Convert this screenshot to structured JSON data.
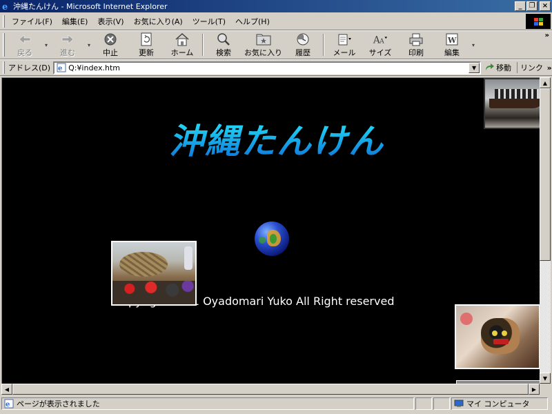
{
  "window": {
    "title": "沖縄たんけん - Microsoft Internet Explorer",
    "minimize": "_",
    "restore": "❐",
    "close": "×"
  },
  "menu": {
    "items": [
      "ファイル(F)",
      "編集(E)",
      "表示(V)",
      "お気に入り(A)",
      "ツール(T)",
      "ヘルプ(H)"
    ]
  },
  "toolbar": {
    "back": "戻る",
    "forward": "進む",
    "stop": "中止",
    "refresh": "更新",
    "home": "ホーム",
    "search": "検索",
    "favorites": "お気に入り",
    "history": "履歴",
    "mail": "メール",
    "size": "サイズ",
    "print": "印刷",
    "edit": "編集",
    "more": "»"
  },
  "address": {
    "label": "アドレス(D)",
    "value": "Q:¥index.htm",
    "go": "移動",
    "links": "リンク",
    "more": "»"
  },
  "page": {
    "title": "沖縄たんけん",
    "copyright": "Copyright 2001 Oyadomari Yuko All Right reserved"
  },
  "status": {
    "message": "ページが表示されました",
    "zone": "マイ コンピュータ"
  },
  "colors": {
    "title_blue": "#0a246a",
    "chrome": "#d4d0c8",
    "content_bg": "#000000",
    "page_title_gradient_top": "#2af0ff",
    "page_title_gradient_bottom": "#0c6bd8"
  }
}
